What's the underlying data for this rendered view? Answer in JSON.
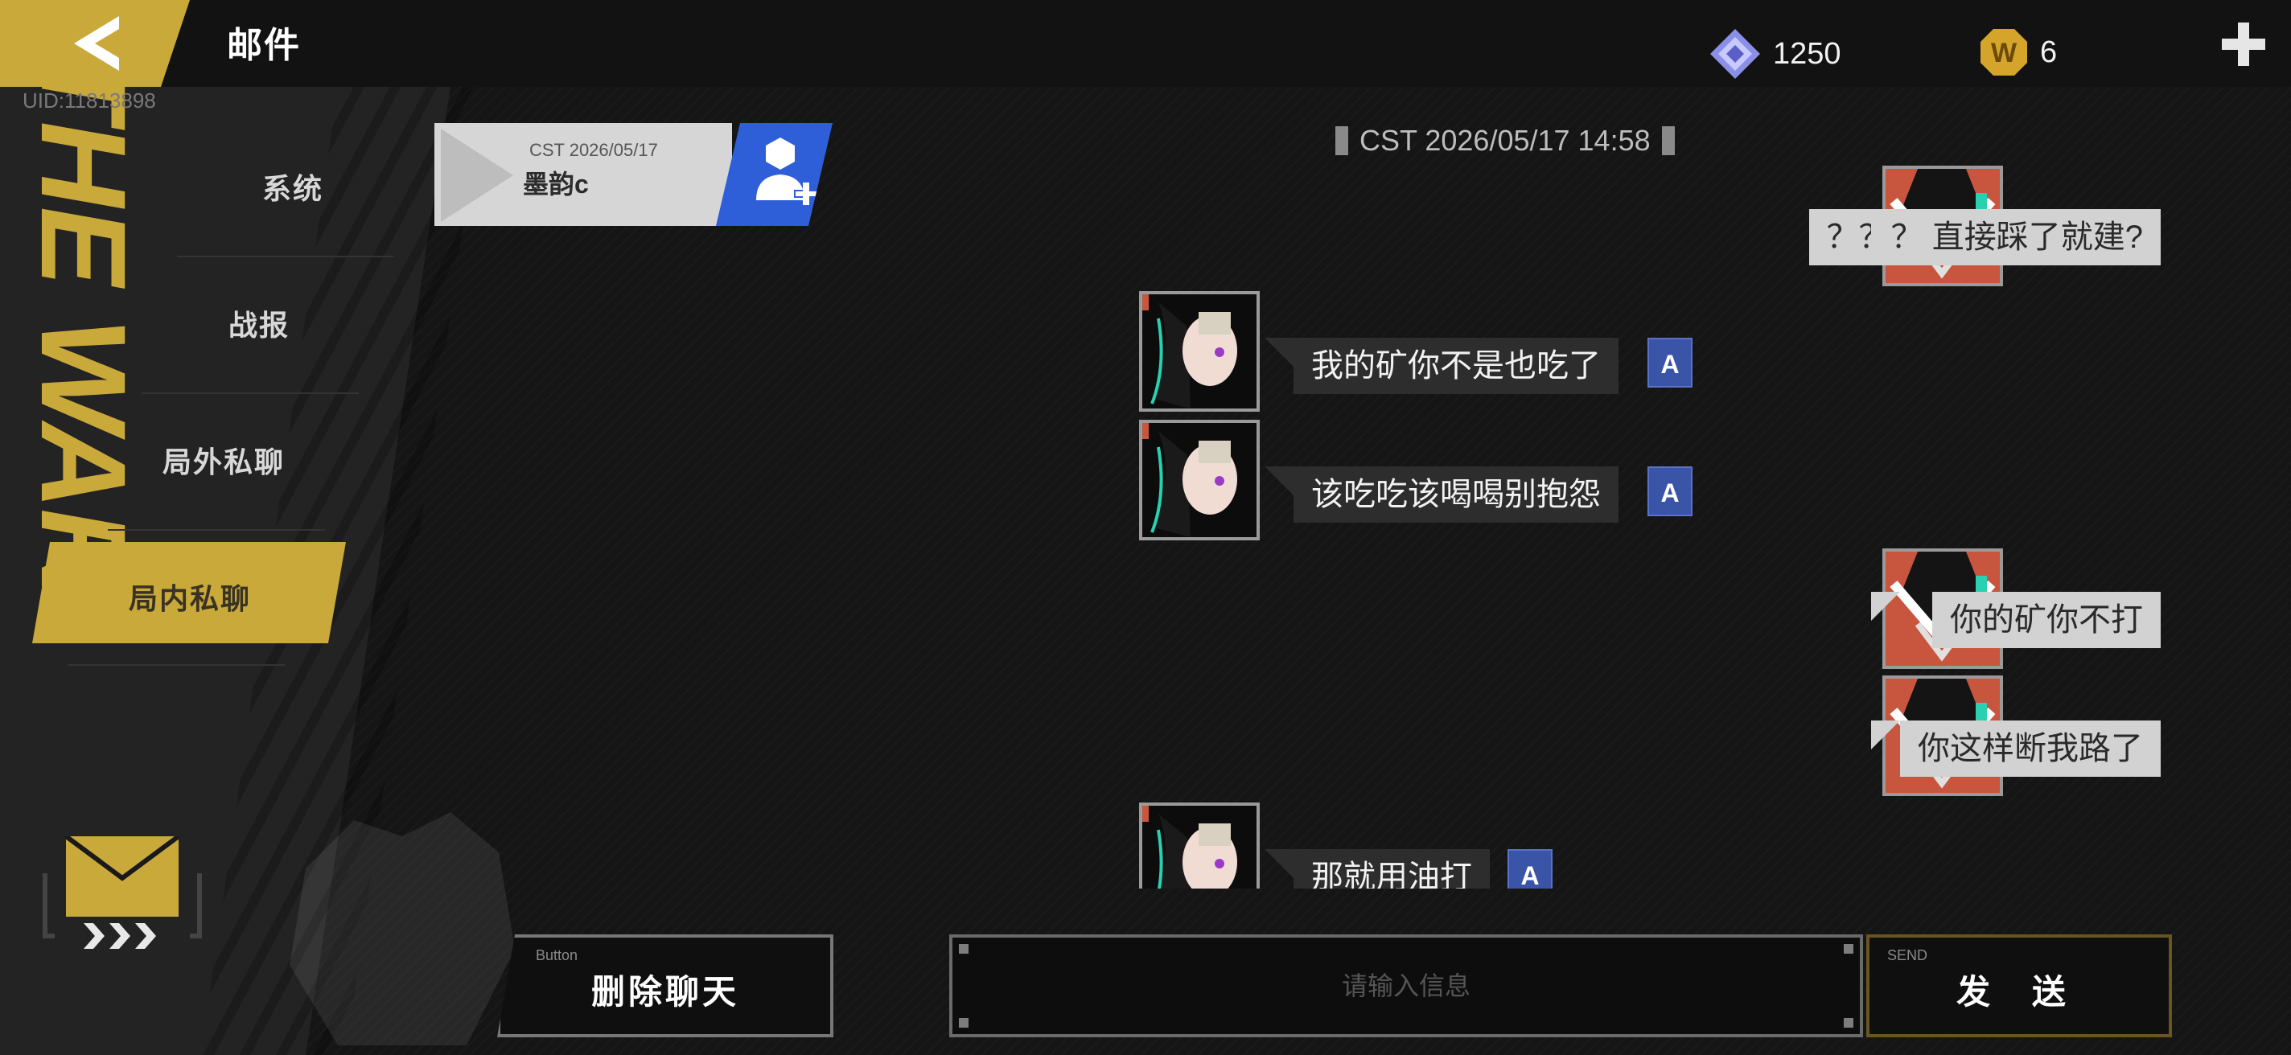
{
  "header": {
    "title": "邮件",
    "uid": "UID:11813898",
    "currencies": [
      {
        "icon": "diamond-gem-icon",
        "amount": "1250"
      },
      {
        "icon": "gold-w-coin-icon",
        "amount": "6"
      }
    ]
  },
  "sidebar": {
    "banner_text": "THE WAR",
    "items": [
      {
        "label": "系统",
        "active": false
      },
      {
        "label": "战报",
        "active": false
      },
      {
        "label": "局外私聊",
        "active": false
      },
      {
        "label": "局内私聊",
        "active": true
      }
    ]
  },
  "contacts": [
    {
      "date": "CST 2026/05/17",
      "name": "墨韵c"
    }
  ],
  "chat": {
    "timestamp": "CST 2026/05/17 14:58",
    "messages": [
      {
        "from": "me",
        "text": "？？？ 直接踩了就建?"
      },
      {
        "from": "them",
        "text": "我的矿你不是也吃了"
      },
      {
        "from": "them",
        "text": "该吃吃该喝喝别抱怨"
      },
      {
        "from": "me",
        "text": "你的矿你不打"
      },
      {
        "from": "me",
        "text": "你这样断我路了"
      },
      {
        "from": "them",
        "text": "那就用油打"
      }
    ],
    "translate_symbol": "A"
  },
  "footer": {
    "delete_tag": "Button",
    "delete_label": "删除聊天",
    "input_placeholder": "请输入信息",
    "send_tag": "SEND",
    "send_label": "发 送"
  },
  "colors": {
    "accent_gold": "#c9a93a",
    "add_friend_blue": "#2f5fd8",
    "translate_blue": "#3a54a8"
  }
}
